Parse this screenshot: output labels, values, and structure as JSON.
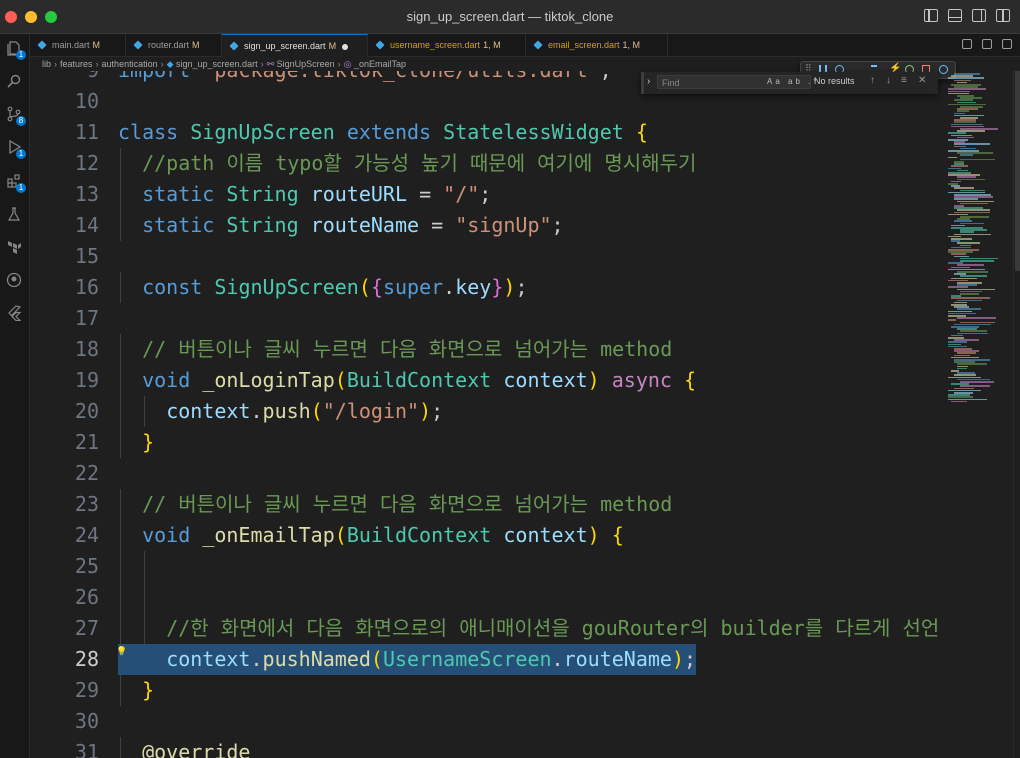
{
  "window": {
    "title": "sign_up_screen.dart — tiktok_clone"
  },
  "activity_bar": [
    {
      "name": "explorer-icon",
      "badge": "1"
    },
    {
      "name": "search-icon",
      "badge": ""
    },
    {
      "name": "source-control-icon",
      "badge": "8"
    },
    {
      "name": "run-debug-icon",
      "badge": "1"
    },
    {
      "name": "extensions-icon",
      "badge": "1"
    },
    {
      "name": "testing-icon",
      "badge": ""
    },
    {
      "name": "terraform-icon",
      "badge": ""
    },
    {
      "name": "github-icon",
      "badge": ""
    },
    {
      "name": "flutter-icon",
      "badge": ""
    }
  ],
  "tabs": [
    {
      "label": "main.dart",
      "status": "M",
      "warn": false,
      "active": false
    },
    {
      "label": "router.dart",
      "status": "M",
      "warn": false,
      "active": false
    },
    {
      "label": "sign_up_screen.dart",
      "status": "M",
      "warn": false,
      "active": true
    },
    {
      "label": "username_screen.dart",
      "status": "1, M",
      "warn": true,
      "active": false
    },
    {
      "label": "email_screen.dart",
      "status": "1, M",
      "warn": true,
      "active": false
    }
  ],
  "breadcrumb": {
    "parts": [
      "lib",
      "features",
      "authentication",
      "sign_up_screen.dart"
    ],
    "class_symbol": "SignUpScreen",
    "method_symbol": "_onEmailTap"
  },
  "find_widget": {
    "placeholder": "Find",
    "options": "Aa ab .*",
    "result": "No results"
  },
  "editor": {
    "current_line": "28",
    "lines": [
      {
        "n": "9",
        "text": "import 'package:tiktok_clone/utils.dart';"
      },
      {
        "n": "10",
        "text": ""
      },
      {
        "n": "11",
        "text": "class SignUpScreen extends StatelessWidget {"
      },
      {
        "n": "12",
        "text": "//path 이름 typo할 가능성 높기 때문에 여기에 명시해두기"
      },
      {
        "n": "13",
        "text": "static String routeURL = \"/\";"
      },
      {
        "n": "14",
        "text": "static String routeName = \"signUp\";"
      },
      {
        "n": "15",
        "text": ""
      },
      {
        "n": "16",
        "text": "const SignUpScreen({super.key});"
      },
      {
        "n": "17",
        "text": ""
      },
      {
        "n": "18",
        "text": "// 버튼이나 글씨 누르면 다음 화면으로 넘어가는 method"
      },
      {
        "n": "19",
        "text": "void _onLoginTap(BuildContext context) async {"
      },
      {
        "n": "20",
        "text": "context.push(\"/login\");"
      },
      {
        "n": "21",
        "text": "}"
      },
      {
        "n": "22",
        "text": ""
      },
      {
        "n": "23",
        "text": "// 버튼이나 글씨 누르면 다음 화면으로 넘어가는 method"
      },
      {
        "n": "24",
        "text": "void _onEmailTap(BuildContext context) {"
      },
      {
        "n": "25",
        "text": ""
      },
      {
        "n": "26",
        "text": ""
      },
      {
        "n": "27",
        "text": "//한 화면에서 다음 화면으로의 애니매이션을 gouRouter의 builder를 다르게 선언"
      },
      {
        "n": "28",
        "text": "context.pushNamed(UsernameScreen.routeName);"
      },
      {
        "n": "29",
        "text": "}"
      },
      {
        "n": "30",
        "text": ""
      },
      {
        "n": "31",
        "text": "@override"
      }
    ]
  },
  "colors": {
    "accent": "#0078d4",
    "keyword": "#569cd6",
    "type": "#4ec9b0",
    "function": "#dcdcaa",
    "variable": "#9cdcfe",
    "string": "#ce9178",
    "comment": "#6a9955",
    "selection": "#264f78"
  }
}
